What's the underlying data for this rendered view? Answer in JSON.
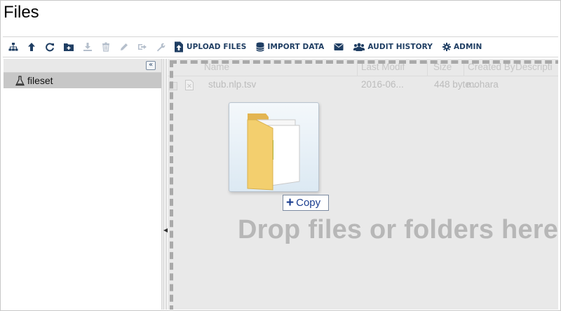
{
  "page": {
    "title": "Files"
  },
  "toolbar": {
    "upload_label": "UPLOAD FILES",
    "import_label": "IMPORT DATA",
    "audit_label": "AUDIT HISTORY",
    "admin_label": "ADMIN",
    "icons": [
      "sitemap-icon",
      "arrow-up-icon",
      "refresh-icon",
      "new-folder-icon",
      "download-icon",
      "trash-icon",
      "pencil-icon",
      "move-icon",
      "wrench-icon",
      "upload-icon",
      "database-icon",
      "envelope-icon",
      "users-icon",
      "gear-icon"
    ]
  },
  "tree": {
    "collapse_glyph": "«",
    "items": [
      {
        "label": "fileset"
      }
    ]
  },
  "grid": {
    "columns": [
      "Name",
      "Last Modif",
      "Size",
      "Created By",
      "Descripti"
    ],
    "rows": [
      {
        "name": "stub.nlp.tsv",
        "modified": "2016-06...",
        "size": "448 byte...",
        "created_by": "mohara",
        "description": ""
      }
    ]
  },
  "dropzone": {
    "text": "Drop files or folders here"
  },
  "drag": {
    "tooltip_label": "Copy",
    "tooltip_icon": "plus-icon"
  },
  "colors": {
    "accent": "#1f3e63",
    "disabled": "#b5bfcc",
    "folder": "#f3cf6e"
  }
}
